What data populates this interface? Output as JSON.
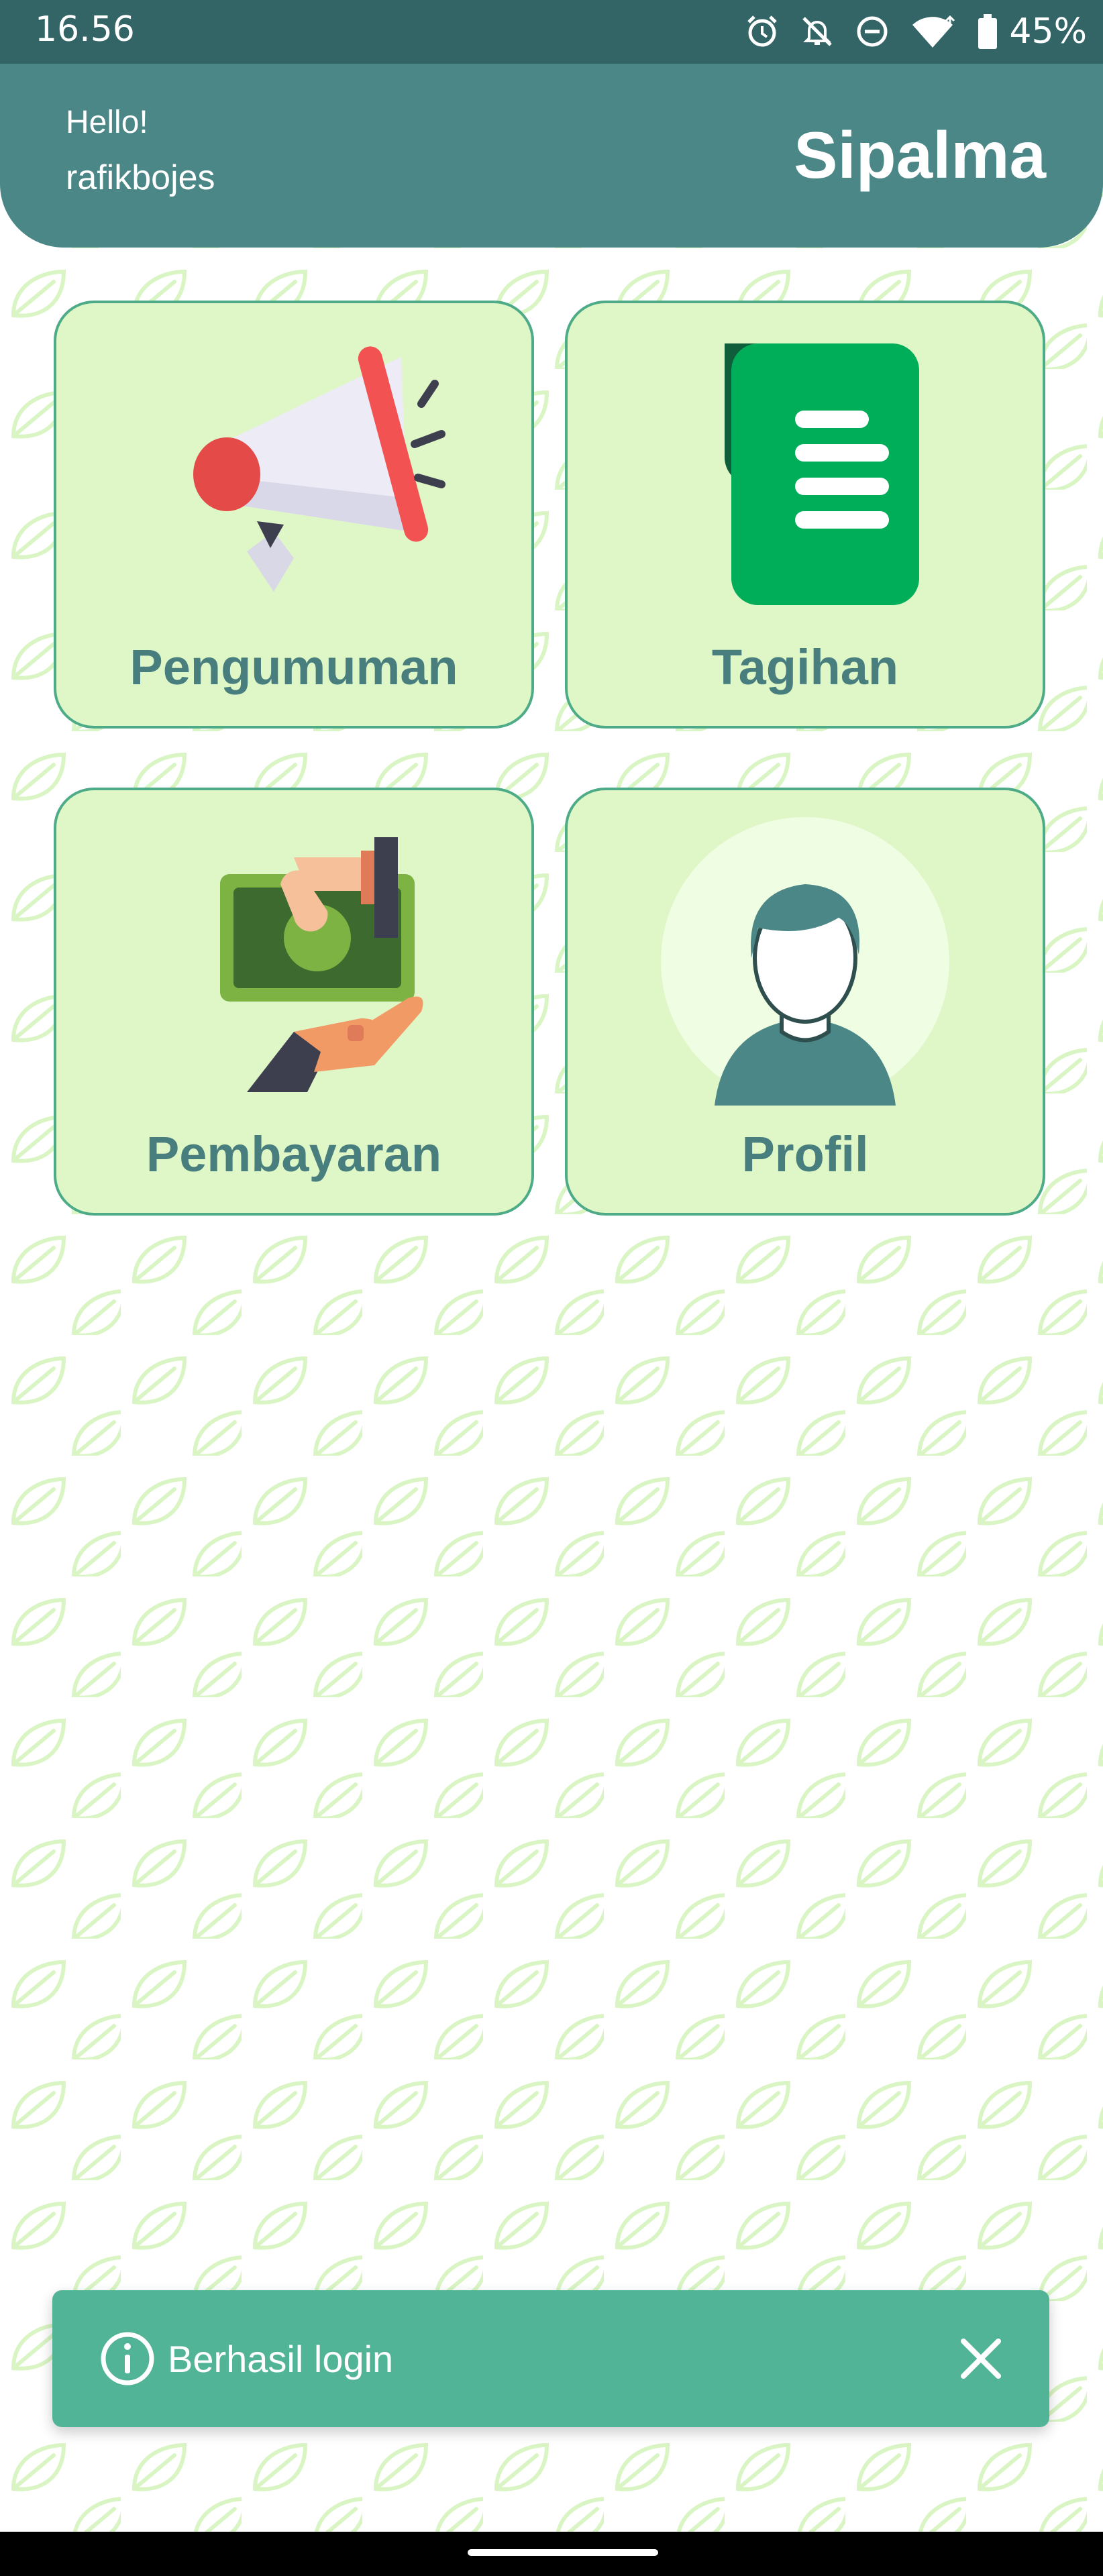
{
  "status_bar": {
    "time": "16.56",
    "battery": "45%",
    "icons": [
      "alarm-icon",
      "bell-off-icon",
      "do-not-disturb-icon",
      "wifi-icon",
      "battery-icon"
    ]
  },
  "header": {
    "greeting": "Hello!",
    "username": "rafikbojes",
    "app_title": "Sipalma"
  },
  "menu": {
    "pengumuman": {
      "label": "Pengumuman",
      "icon": "megaphone-icon"
    },
    "tagihan": {
      "label": "Tagihan",
      "icon": "bill-document-icon"
    },
    "pembayaran": {
      "label": "Pembayaran",
      "icon": "payment-cash-icon"
    },
    "profil": {
      "label": "Profil",
      "icon": "user-avatar-icon"
    }
  },
  "snackbar": {
    "message": "Berhasil login",
    "icon": "info-icon",
    "close_icon": "close-icon"
  },
  "colors": {
    "status_bar": "#336466",
    "header": "#4a8786",
    "card_bg": "#dff7c7",
    "card_border": "#4eab88",
    "card_text": "#487f7e",
    "snackbar": "#52b497"
  }
}
